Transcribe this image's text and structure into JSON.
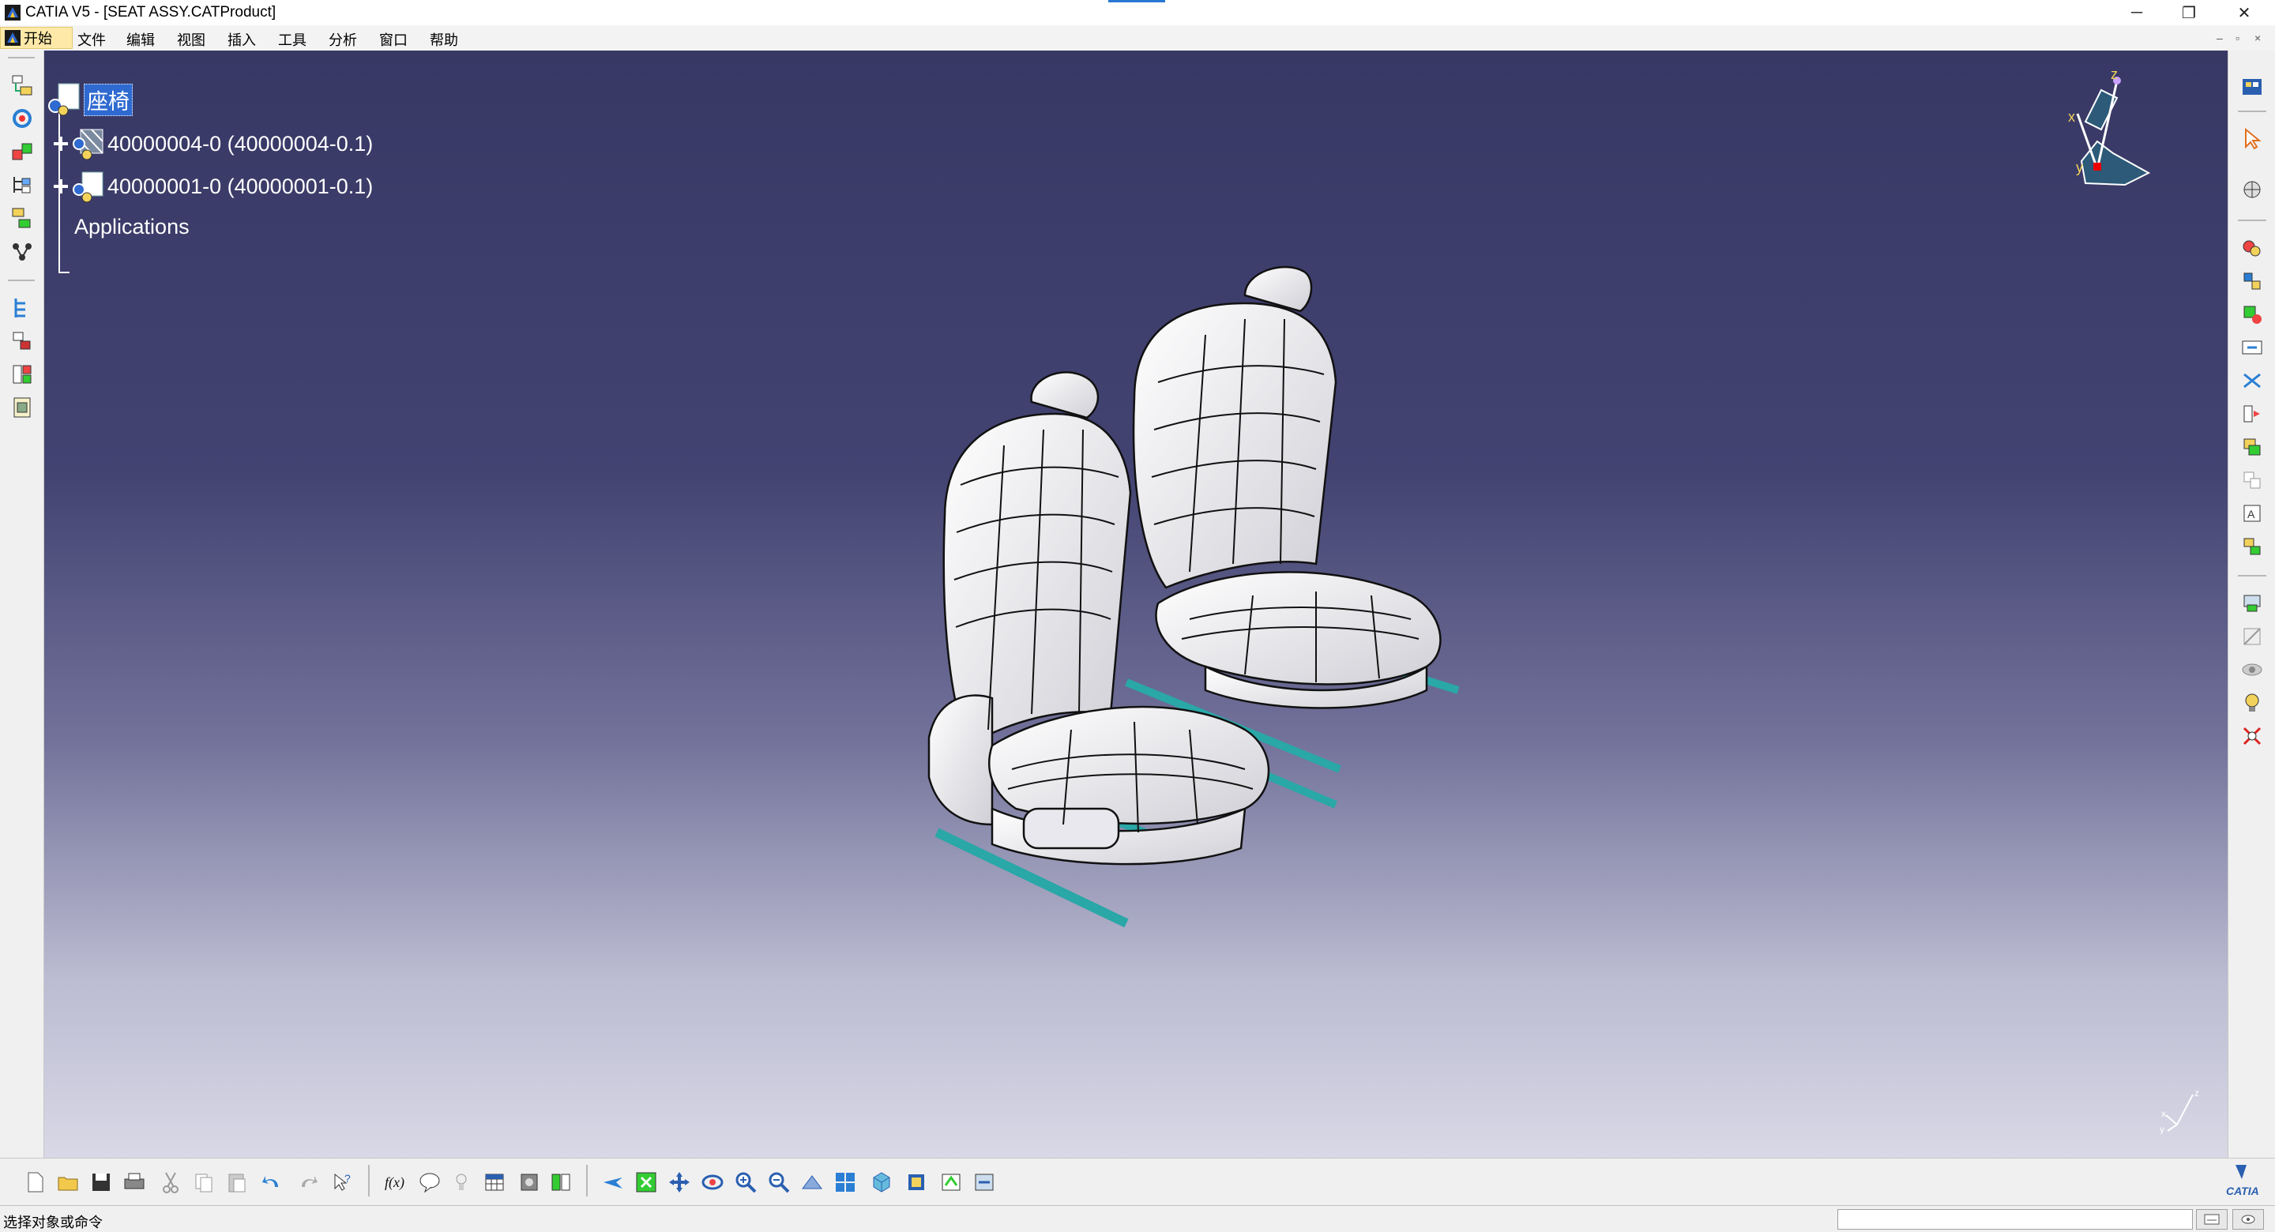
{
  "window": {
    "title": "CATIA V5 - [SEAT ASSY.CATProduct]",
    "min_icon": "─",
    "restore_icon": "❐",
    "close_icon": "✕"
  },
  "menu": {
    "start": "开始",
    "items": [
      "文件",
      "编辑",
      "视图",
      "插入",
      "工具",
      "分析",
      "窗口",
      "帮助"
    ],
    "mdi_min": "–",
    "mdi_restore": "▫",
    "mdi_close": "×"
  },
  "tree": {
    "root": "座椅",
    "children": [
      {
        "label": "40000004-0 (40000004-0.1)"
      },
      {
        "label": "40000001-0 (40000001-0.1)"
      }
    ],
    "applications": "Applications"
  },
  "compass": {
    "x": "x",
    "y": "y",
    "z": "z"
  },
  "status": {
    "message": "选择对象或命令",
    "command_value": ""
  },
  "colors": {
    "viewport_top": "#383865",
    "viewport_bottom": "#d8d8e6",
    "tree_selection": "#2f6ad0",
    "rail": "#2aa7a7"
  },
  "icons": {
    "left_toolbar": [
      "product-structure-icon",
      "update-icon",
      "new-component-icon",
      "existing-component-icon",
      "replace-component-icon",
      "graph-tree-reorder-icon",
      "generate-numbering-icon",
      "selective-load-icon",
      "manage-representations-icon",
      "multi-instantiation-icon"
    ],
    "right_toolbar": [
      "catalog-browser-icon",
      "select-icon",
      "snap-icon",
      "manipulation-icon",
      "explode-icon",
      "stop-manipulation-icon",
      "coincidence-constraint-icon",
      "contact-constraint-icon",
      "offset-constraint-icon",
      "angle-constraint-icon",
      "fix-component-icon",
      "fix-together-icon",
      "quick-constraint-icon",
      "reuse-pattern-icon",
      "flexible-subassembly-icon",
      "change-constraint-icon",
      "hide-show-icon",
      "swap-visible-space-icon",
      "light-icon",
      "measure-icon"
    ],
    "bottom_toolbar": [
      "new-icon",
      "open-icon",
      "save-icon",
      "print-icon",
      "cut-icon",
      "copy-icon",
      "paste-icon",
      "undo-icon",
      "redo-icon",
      "whats-this-icon",
      "formula-icon",
      "knowledge-icon",
      "light-bulb-icon",
      "table-icon",
      "bom-icon",
      "parameters-icon",
      "fly-mode-icon",
      "fit-all-icon",
      "pan-icon",
      "rotate-icon",
      "zoom-in-icon",
      "zoom-out-icon",
      "normal-view-icon",
      "multi-view-icon",
      "iso-view-icon",
      "shading-icon",
      "hide-show-icon",
      "swap-space-icon"
    ]
  }
}
